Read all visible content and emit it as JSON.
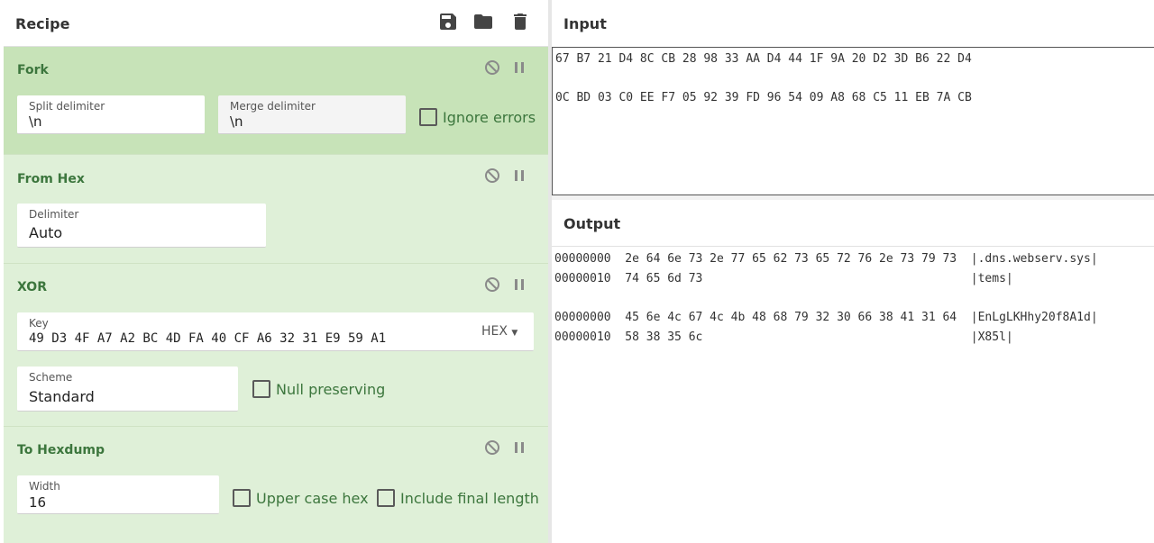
{
  "recipe": {
    "title": "Recipe",
    "icons": [
      "save-icon",
      "folder-icon",
      "trash-icon"
    ],
    "operations": {
      "fork": {
        "title": "Fork",
        "split_label": "Split delimiter",
        "split_value": "\\n",
        "merge_label": "Merge delimiter",
        "merge_value": "\\n",
        "ignore_errors": "Ignore errors"
      },
      "from_hex": {
        "title": "From Hex",
        "delimiter_label": "Delimiter",
        "delimiter_value": "Auto"
      },
      "xor": {
        "title": "XOR",
        "key_label": "Key",
        "key_value": "49 D3 4F A7 A2 BC 4D FA 40 CF A6 32 31 E9 59 A1",
        "key_format": "HEX",
        "scheme_label": "Scheme",
        "scheme_value": "Standard",
        "null_preserving": "Null preserving"
      },
      "to_hexdump": {
        "title": "To Hexdump",
        "width_label": "Width",
        "width_value": "16",
        "upper_case_hex": "Upper case hex",
        "include_final_length": "Include final length"
      }
    }
  },
  "input": {
    "title": "Input",
    "lines": [
      "67 B7 21 D4 8C CB 28 98 33 AA D4 44 1F 9A 20 D2 3D B6 22 D4",
      "0C BD 03 C0 EE F7 05 92 39 FD 96 54 09 A8 68 C5 11 EB 7A CB"
    ]
  },
  "output": {
    "title": "Output",
    "lines": [
      "00000000  2e 64 6e 73 2e 77 65 62 73 65 72 76 2e 73 79 73  |.dns.webserv.sys|",
      "00000010  74 65 6d 73                                      |tems|",
      "00000000  45 6e 4c 67 4c 4b 48 68 79 32 30 66 38 41 31 64  |EnLgLKHhy20f8A1d|",
      "00000010  58 38 35 6c                                      |X85l|"
    ]
  },
  "colors": {
    "op_bg": "#dff0d8",
    "op_active_bg": "#c7e3b8",
    "op_title": "#3c763d"
  }
}
